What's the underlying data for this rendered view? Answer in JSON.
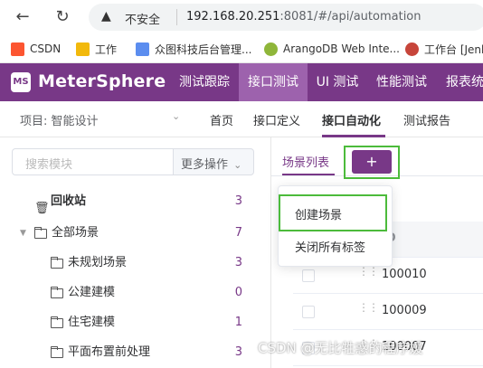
{
  "browser": {
    "security_label": "不安全",
    "url_host": "192.168.20.251",
    "url_rest": ":8081/#/api/automation",
    "bookmarks": [
      {
        "label": "CSDN",
        "color": "#fc5531"
      },
      {
        "label": "工作",
        "color": "#f2b90c"
      },
      {
        "label": "众图科技后台管理...",
        "color": "#5b8def"
      },
      {
        "label": "ArangoDB Web Inte...",
        "color": "#8fb63a"
      },
      {
        "label": "工作台 [Jenk",
        "color": "#c7453a"
      }
    ]
  },
  "header": {
    "logo_mark": "MS",
    "logo_text": "MeterSphere",
    "nav": [
      "测试跟踪",
      "接口测试",
      "UI 测试",
      "性能测试",
      "报表统"
    ],
    "active_index": 1,
    "brand_color": "#783887"
  },
  "subheader": {
    "project": "项目: 智能设计",
    "nav": [
      "首页",
      "接口定义",
      "接口自动化",
      "测试报告"
    ],
    "active_index": 2
  },
  "sidebar": {
    "search_placeholder": "搜索模块",
    "more_ops": "更多操作",
    "recycle": {
      "label": "回收站",
      "count": "3"
    },
    "all": {
      "label": "全部场景",
      "count": "7"
    },
    "children": [
      {
        "label": "未规划场景",
        "count": "3"
      },
      {
        "label": "公建建模",
        "count": "0"
      },
      {
        "label": "住宅建模",
        "count": "1"
      },
      {
        "label": "平面布置前处理",
        "count": "3"
      }
    ]
  },
  "main": {
    "tab_scene": "场景列表",
    "add_tab": "+",
    "header_partial": "ID",
    "rows": [
      "100010",
      "100009",
      "100007"
    ]
  },
  "dropdown": {
    "items": [
      "创建场景",
      "关闭所有标签"
    ]
  },
  "watermark": "CSDN @无比牲惑的程序媛"
}
